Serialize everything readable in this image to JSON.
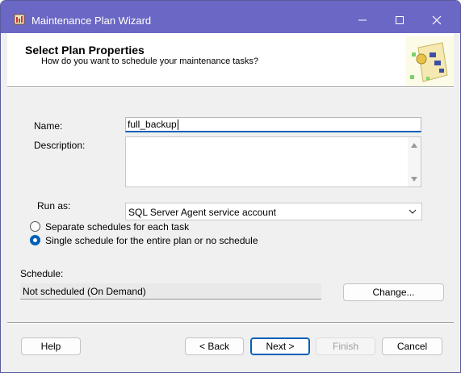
{
  "window": {
    "title": "Maintenance Plan Wizard"
  },
  "header": {
    "title": "Select Plan Properties",
    "subtitle": "How do you want to schedule your maintenance tasks?"
  },
  "form": {
    "name_label": "Name:",
    "name_value": "full_backup",
    "description_label": "Description:",
    "description_value": "",
    "run_as_label": "Run as:",
    "run_as_value": "SQL Server Agent service account",
    "radio_options": [
      {
        "label": "Separate schedules for each task",
        "checked": false
      },
      {
        "label": "Single schedule for the entire plan or no schedule",
        "checked": true
      }
    ],
    "schedule_label": "Schedule:",
    "schedule_value": "Not scheduled (On Demand)",
    "change_button": "Change..."
  },
  "buttons": {
    "help": "Help",
    "back": "< Back",
    "next": "Next >",
    "finish": "Finish",
    "cancel": "Cancel"
  },
  "colors": {
    "titlebar": "#6b67c4",
    "accent": "#005fb8",
    "body_bg": "#f0f0f0"
  },
  "icons": [
    "app-icon",
    "minimize-icon",
    "maximize-icon",
    "close-icon",
    "wizard-graphic",
    "scroll-up-icon",
    "scroll-down-icon",
    "chevron-down-icon"
  ]
}
